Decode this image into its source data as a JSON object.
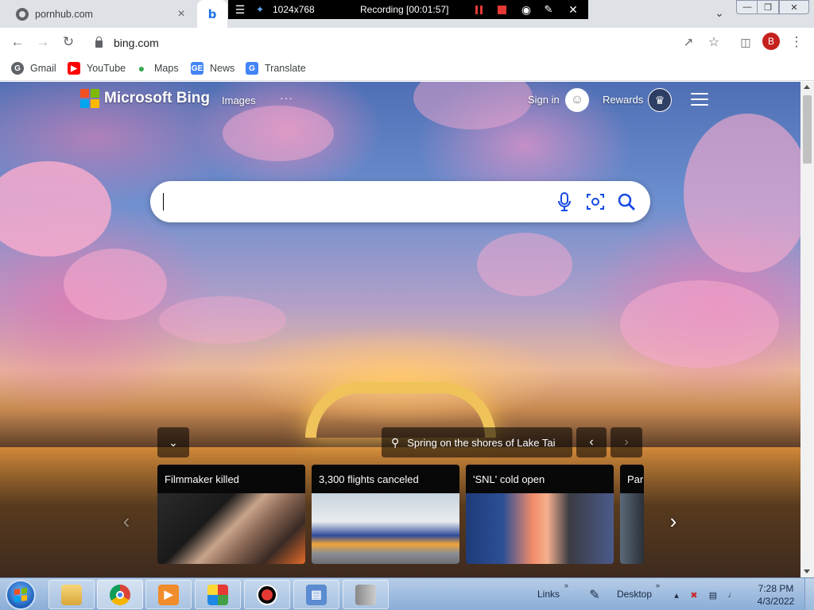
{
  "browser": {
    "tabs": [
      {
        "title": "pornhub.com"
      },
      {
        "title": ""
      }
    ],
    "address": "bing.com",
    "profile_initial": "B",
    "bookmarks": [
      {
        "label": "Gmail",
        "icon": "gmail-icon",
        "color": "#EA4335"
      },
      {
        "label": "YouTube",
        "icon": "youtube-icon",
        "color": "#FF0000"
      },
      {
        "label": "Maps",
        "icon": "maps-icon",
        "color": "#34A853"
      },
      {
        "label": "News",
        "icon": "news-icon",
        "color": "#4285F4"
      },
      {
        "label": "Translate",
        "icon": "translate-icon",
        "color": "#4285F4"
      }
    ]
  },
  "recorder": {
    "size": "1024x768",
    "status": "Recording [00:01:57]"
  },
  "bing": {
    "logo_text": "Microsoft Bing",
    "nav": {
      "images": "Images",
      "more": "···"
    },
    "sign_in": "Sign in",
    "rewards": "Rewards",
    "search_value": "",
    "location_caption": "Spring on the shores of Lake Tai",
    "news": [
      {
        "title": "Filmmaker killed"
      },
      {
        "title": "3,300 flights canceled"
      },
      {
        "title": "'SNL' cold open"
      },
      {
        "title": "Parl"
      }
    ]
  },
  "taskbar": {
    "links": "Links",
    "desktop": "Desktop",
    "time": "7:28 PM",
    "date": "4/3/2022"
  },
  "colors": {
    "bing_accent": "#174AE4",
    "recording_red": "#E53935",
    "profile_red": "#C5221F"
  }
}
